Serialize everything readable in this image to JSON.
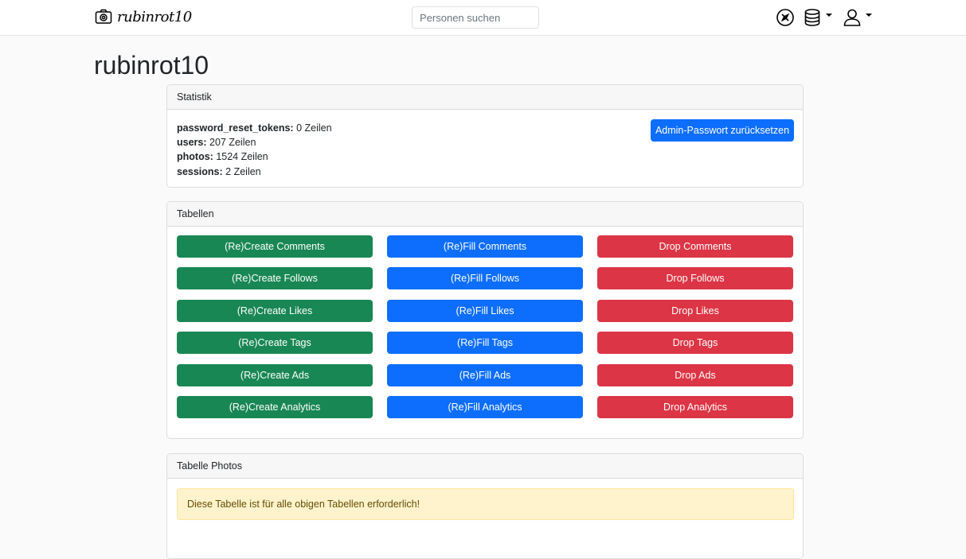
{
  "navbar": {
    "brand_text": "rubinrot10",
    "brand_icon": "camera-icon",
    "search_placeholder": "Personen suchen",
    "icons": [
      "compass-icon",
      "database-icon",
      "user-icon"
    ]
  },
  "page": {
    "title": "rubinrot10"
  },
  "statistik": {
    "header": "Statistik",
    "rows": [
      {
        "name": "password_reset_tokens:",
        "value": "0 Zeilen"
      },
      {
        "name": "users:",
        "value": "207 Zeilen"
      },
      {
        "name": "photos:",
        "value": "1524 Zeilen"
      },
      {
        "name": "sessions:",
        "value": "2 Zeilen"
      }
    ],
    "reset_button": "Admin-Passwort zurücksetzen"
  },
  "tabellen": {
    "header": "Tabellen",
    "rows": [
      {
        "create": "(Re)Create Comments",
        "fill": "(Re)Fill Comments",
        "drop": "Drop Comments"
      },
      {
        "create": "(Re)Create Follows",
        "fill": "(Re)Fill Follows",
        "drop": "Drop Follows"
      },
      {
        "create": "(Re)Create Likes",
        "fill": "(Re)Fill Likes",
        "drop": "Drop Likes"
      },
      {
        "create": "(Re)Create Tags",
        "fill": "(Re)Fill Tags",
        "drop": "Drop Tags"
      },
      {
        "create": "(Re)Create Ads",
        "fill": "(Re)Fill Ads",
        "drop": "Drop Ads"
      },
      {
        "create": "(Re)Create Analytics",
        "fill": "(Re)Fill Analytics",
        "drop": "Drop Analytics"
      }
    ]
  },
  "photos_table": {
    "header": "Tabelle Photos",
    "alert": "Diese Tabelle ist für alle obigen Tabellen erforderlich!"
  },
  "colors": {
    "create": "#198754",
    "fill": "#0d6efd",
    "drop": "#dc3545",
    "alert_bg": "#fff3cd"
  }
}
